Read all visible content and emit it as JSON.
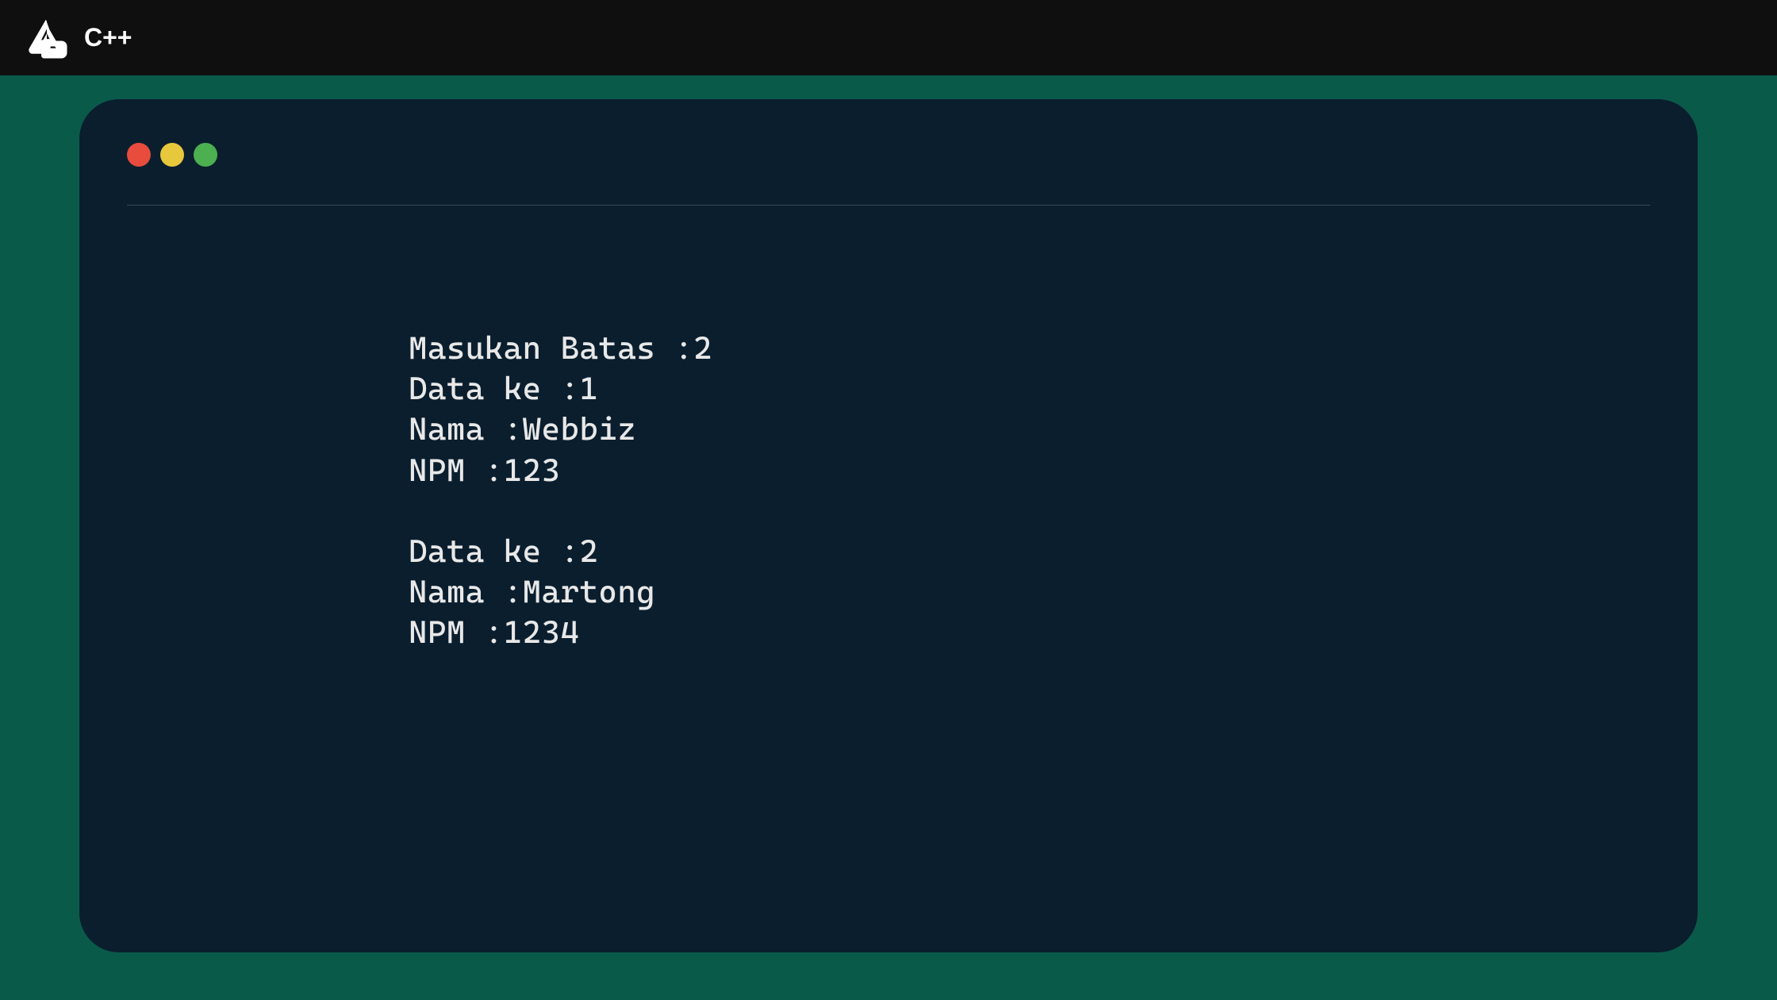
{
  "header": {
    "title": "C++"
  },
  "window_controls": {
    "colors": {
      "close": "#e74c3c",
      "minimize": "#e7c73c",
      "maximize": "#4caf50"
    }
  },
  "terminal": {
    "lines": [
      "Masukan Batas :2",
      "Data ke :1",
      "Nama :Webbiz",
      "NPM :123",
      "",
      "Data ke :2",
      "Nama :Martong",
      "NPM :1234"
    ]
  }
}
